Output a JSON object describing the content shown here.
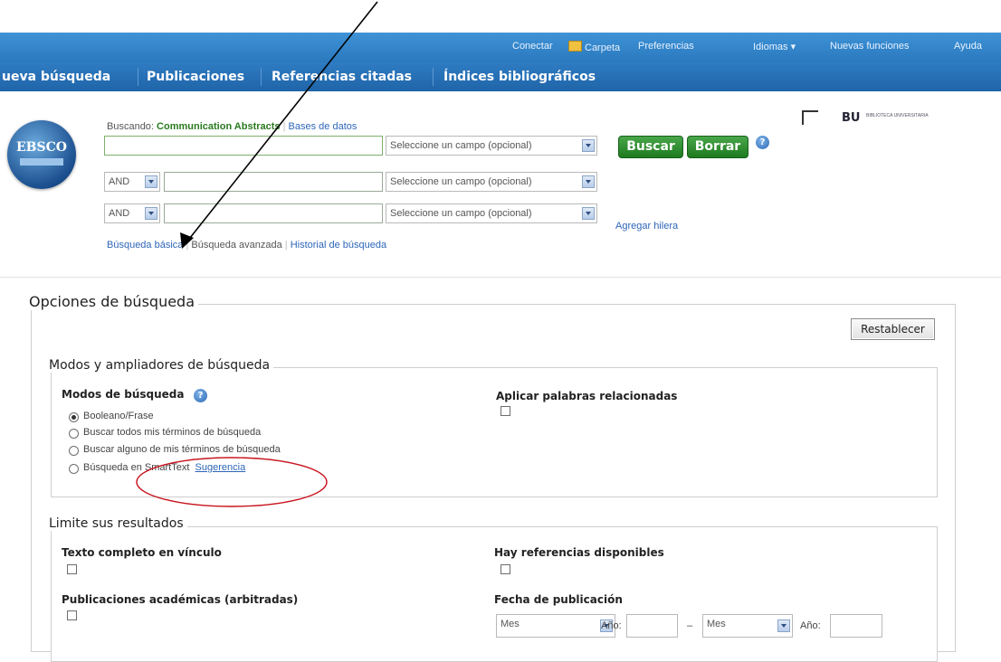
{
  "topbar": {
    "conectar": "Conectar",
    "carpeta": "Carpeta",
    "preferencias": "Preferencias",
    "idiomas": "Idiomas",
    "nuevas_funciones": "Nuevas funciones",
    "ayuda": "Ayuda"
  },
  "nav": {
    "nueva_busqueda": "ueva búsqueda",
    "publicaciones": "Publicaciones",
    "referencias": "Referencias citadas",
    "indices": "Índices bibliográficos"
  },
  "logo": {
    "text": "EBSCO"
  },
  "search": {
    "buscando_label": "Buscando:",
    "database": "Communication Abstracts",
    "bases_link": "Bases de datos",
    "field_placeholder": "Seleccione un campo (opcional)",
    "operator_1": "AND",
    "operator_2": "AND",
    "buscar": "Buscar",
    "borrar": "Borrar",
    "agregar_hilera": "Agregar hilera",
    "basica": "Búsqueda básica",
    "avanzada": "Búsqueda avanzada",
    "historial": "Historial de búsqueda"
  },
  "branding": {
    "bu": "BU",
    "biblioteca": "BIBLIOTECA UNIVERSITARIA"
  },
  "options": {
    "title": "Opciones de búsqueda",
    "restablecer": "Restablecer",
    "modos_section": "Modos y ampliadores de búsqueda",
    "modos_label": "Modos de búsqueda",
    "radio_1": "Booleano/Frase",
    "radio_2": "Buscar todos mis términos de búsqueda",
    "radio_3": "Buscar alguno de mis términos de búsqueda",
    "radio_4": "Búsqueda en SmartText",
    "sugerencia": "Sugerencia",
    "aplicar": "Aplicar palabras relacionadas",
    "limite_section": "Limite sus resultados",
    "texto_completo": "Texto completo en vínculo",
    "referencias_disp": "Hay referencias disponibles",
    "publicaciones_acad": "Publicaciones académicas (arbitradas)",
    "fecha_pub": "Fecha de publicación",
    "mes": "Mes",
    "anio": "Año:",
    "dash": "–"
  },
  "colors": {
    "topbar": "#3f93d6",
    "navbar": "#1f64a8",
    "green_button": "#2a8a2a",
    "annotation_red": "#c8141e"
  }
}
